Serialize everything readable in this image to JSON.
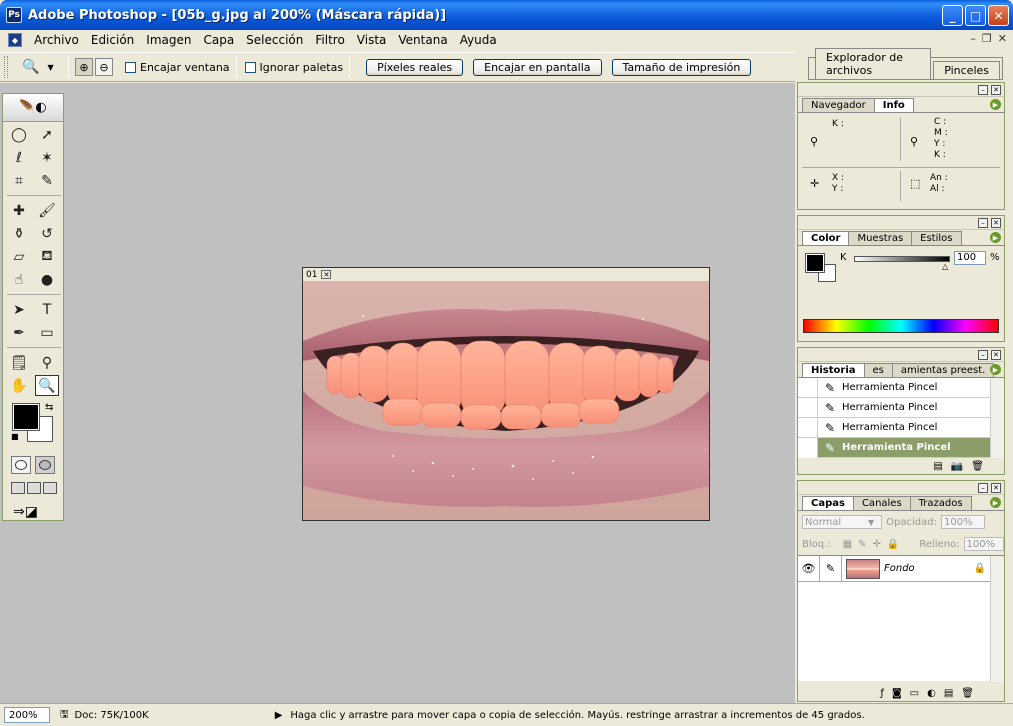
{
  "window": {
    "title": "Adobe Photoshop - [05b_g.jpg al 200% (Máscara rápida)]",
    "minimize": "_",
    "maximize": "□",
    "close": "✕"
  },
  "menu": {
    "items": [
      "Archivo",
      "Edición",
      "Imagen",
      "Capa",
      "Selección",
      "Filtro",
      "Vista",
      "Ventana",
      "Ayuda"
    ]
  },
  "options": {
    "fit_window_label": "Encajar ventana",
    "ignore_palettes_label": "Ignorar paletas",
    "actual_pixels_label": "Píxeles reales",
    "fit_screen_label": "Encajar en pantalla",
    "print_size_label": "Tamaño de impresión"
  },
  "palette_well": {
    "tabs": [
      "Explorador de archivos",
      "Pinceles"
    ]
  },
  "document": {
    "tab_label": "01"
  },
  "navigator_palette": {
    "tabs": [
      "Navegador",
      "Info"
    ],
    "active_tab": "Info",
    "k_label": "K :",
    "cmyk_labels": [
      "C :",
      "M :",
      "Y :",
      "K :"
    ],
    "xy_labels": [
      "X :",
      "Y :"
    ],
    "size_labels": [
      "An :",
      "Al :"
    ]
  },
  "color_palette": {
    "tabs": [
      "Color",
      "Muestras",
      "Estilos"
    ],
    "active_tab": "Color",
    "channel_label": "K",
    "channel_value": "100",
    "unit": "%"
  },
  "history_palette": {
    "tabs": [
      "Historia",
      "es",
      "amientas preest."
    ],
    "active_tab": "Historia",
    "items": [
      {
        "label": "Herramienta Pincel",
        "selected": false
      },
      {
        "label": "Herramienta Pincel",
        "selected": false
      },
      {
        "label": "Herramienta Pincel",
        "selected": false
      },
      {
        "label": "Herramienta Pincel",
        "selected": true
      }
    ]
  },
  "layers_palette": {
    "tabs": [
      "Capas",
      "Canales",
      "Trazados"
    ],
    "active_tab": "Capas",
    "blend_mode": "Normal",
    "opacity_label": "Opacidad:",
    "opacity_value": "100%",
    "lock_label": "Bloq.:",
    "fill_label": "Relleno:",
    "fill_value": "100%",
    "layers": [
      {
        "name": "Fondo",
        "locked": true
      }
    ]
  },
  "status": {
    "zoom": "200%",
    "doc_size": "Doc: 75K/100K",
    "hint": "Haga clic y arrastre para mover capa o copia de selección. Mayús. restringe arrastrar a incrementos de 45 grados."
  },
  "colors": {
    "foreground": "#000000",
    "background": "#ffffff",
    "workspace": "#c0c0c0",
    "accent": "#8b9e6a"
  }
}
